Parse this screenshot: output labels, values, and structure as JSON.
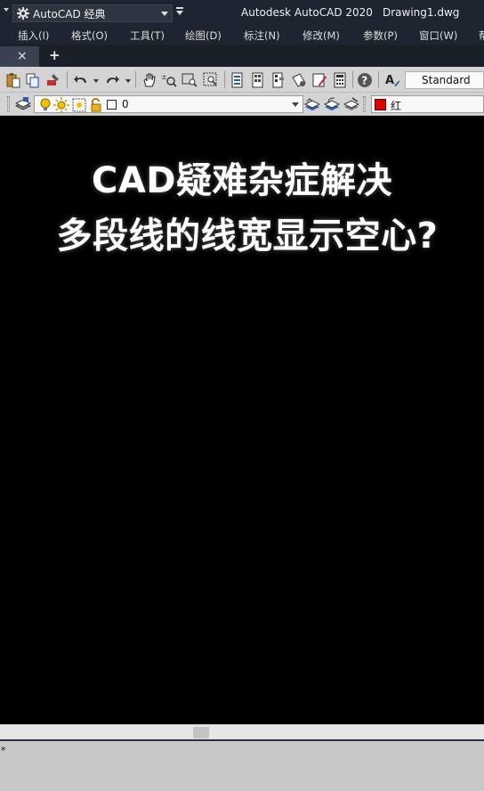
{
  "titlebar": {
    "workspace": "AutoCAD 经典",
    "app_title": "Autodesk AutoCAD 2020",
    "doc_title": "Drawing1.dwg"
  },
  "menu": [
    "插入(I)",
    "格式(O)",
    "工具(T)",
    "绘图(D)",
    "标注(N)",
    "修改(M)",
    "参数(P)",
    "窗口(W)",
    "帮"
  ],
  "tabs": {
    "close": "×",
    "new": "+"
  },
  "toolbar": {
    "text_style": "Standard"
  },
  "layers": {
    "current_layer": "0",
    "current_color": "红",
    "colors": {
      "layer_swatch": "#ffffff",
      "color_swatch": "#e00000"
    }
  },
  "canvas": {
    "caption_line1": "CAD疑难杂症解决",
    "caption_line2": "多段线的线宽显示空心?"
  },
  "command": {
    "prompt": "*"
  },
  "icons": [
    "gear-icon",
    "paste-icon",
    "match-properties-icon",
    "undo-icon",
    "redo-icon",
    "pan-icon",
    "zoom-realtime-icon",
    "zoom-window-icon",
    "zoom-previous-icon",
    "properties-icon",
    "design-center-icon",
    "tool-palettes-icon",
    "sheet-set-icon",
    "markup-icon",
    "calculator-icon",
    "help-icon",
    "text-style-icon",
    "layer-properties-icon",
    "light-bulb-icon",
    "sun-icon",
    "freeze-icon",
    "lock-icon",
    "make-current-icon",
    "layer-previous-icon",
    "layer-state-icon"
  ]
}
